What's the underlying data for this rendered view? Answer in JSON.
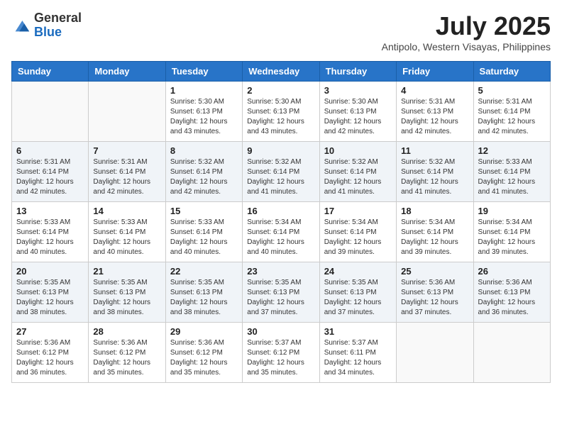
{
  "logo": {
    "general": "General",
    "blue": "Blue"
  },
  "header": {
    "month": "July 2025",
    "location": "Antipolo, Western Visayas, Philippines"
  },
  "weekdays": [
    "Sunday",
    "Monday",
    "Tuesday",
    "Wednesday",
    "Thursday",
    "Friday",
    "Saturday"
  ],
  "weeks": [
    [
      {
        "day": "",
        "info": ""
      },
      {
        "day": "",
        "info": ""
      },
      {
        "day": "1",
        "info": "Sunrise: 5:30 AM\nSunset: 6:13 PM\nDaylight: 12 hours and 43 minutes."
      },
      {
        "day": "2",
        "info": "Sunrise: 5:30 AM\nSunset: 6:13 PM\nDaylight: 12 hours and 43 minutes."
      },
      {
        "day": "3",
        "info": "Sunrise: 5:30 AM\nSunset: 6:13 PM\nDaylight: 12 hours and 42 minutes."
      },
      {
        "day": "4",
        "info": "Sunrise: 5:31 AM\nSunset: 6:13 PM\nDaylight: 12 hours and 42 minutes."
      },
      {
        "day": "5",
        "info": "Sunrise: 5:31 AM\nSunset: 6:14 PM\nDaylight: 12 hours and 42 minutes."
      }
    ],
    [
      {
        "day": "6",
        "info": "Sunrise: 5:31 AM\nSunset: 6:14 PM\nDaylight: 12 hours and 42 minutes."
      },
      {
        "day": "7",
        "info": "Sunrise: 5:31 AM\nSunset: 6:14 PM\nDaylight: 12 hours and 42 minutes."
      },
      {
        "day": "8",
        "info": "Sunrise: 5:32 AM\nSunset: 6:14 PM\nDaylight: 12 hours and 42 minutes."
      },
      {
        "day": "9",
        "info": "Sunrise: 5:32 AM\nSunset: 6:14 PM\nDaylight: 12 hours and 41 minutes."
      },
      {
        "day": "10",
        "info": "Sunrise: 5:32 AM\nSunset: 6:14 PM\nDaylight: 12 hours and 41 minutes."
      },
      {
        "day": "11",
        "info": "Sunrise: 5:32 AM\nSunset: 6:14 PM\nDaylight: 12 hours and 41 minutes."
      },
      {
        "day": "12",
        "info": "Sunrise: 5:33 AM\nSunset: 6:14 PM\nDaylight: 12 hours and 41 minutes."
      }
    ],
    [
      {
        "day": "13",
        "info": "Sunrise: 5:33 AM\nSunset: 6:14 PM\nDaylight: 12 hours and 40 minutes."
      },
      {
        "day": "14",
        "info": "Sunrise: 5:33 AM\nSunset: 6:14 PM\nDaylight: 12 hours and 40 minutes."
      },
      {
        "day": "15",
        "info": "Sunrise: 5:33 AM\nSunset: 6:14 PM\nDaylight: 12 hours and 40 minutes."
      },
      {
        "day": "16",
        "info": "Sunrise: 5:34 AM\nSunset: 6:14 PM\nDaylight: 12 hours and 40 minutes."
      },
      {
        "day": "17",
        "info": "Sunrise: 5:34 AM\nSunset: 6:14 PM\nDaylight: 12 hours and 39 minutes."
      },
      {
        "day": "18",
        "info": "Sunrise: 5:34 AM\nSunset: 6:14 PM\nDaylight: 12 hours and 39 minutes."
      },
      {
        "day": "19",
        "info": "Sunrise: 5:34 AM\nSunset: 6:14 PM\nDaylight: 12 hours and 39 minutes."
      }
    ],
    [
      {
        "day": "20",
        "info": "Sunrise: 5:35 AM\nSunset: 6:13 PM\nDaylight: 12 hours and 38 minutes."
      },
      {
        "day": "21",
        "info": "Sunrise: 5:35 AM\nSunset: 6:13 PM\nDaylight: 12 hours and 38 minutes."
      },
      {
        "day": "22",
        "info": "Sunrise: 5:35 AM\nSunset: 6:13 PM\nDaylight: 12 hours and 38 minutes."
      },
      {
        "day": "23",
        "info": "Sunrise: 5:35 AM\nSunset: 6:13 PM\nDaylight: 12 hours and 37 minutes."
      },
      {
        "day": "24",
        "info": "Sunrise: 5:35 AM\nSunset: 6:13 PM\nDaylight: 12 hours and 37 minutes."
      },
      {
        "day": "25",
        "info": "Sunrise: 5:36 AM\nSunset: 6:13 PM\nDaylight: 12 hours and 37 minutes."
      },
      {
        "day": "26",
        "info": "Sunrise: 5:36 AM\nSunset: 6:13 PM\nDaylight: 12 hours and 36 minutes."
      }
    ],
    [
      {
        "day": "27",
        "info": "Sunrise: 5:36 AM\nSunset: 6:12 PM\nDaylight: 12 hours and 36 minutes."
      },
      {
        "day": "28",
        "info": "Sunrise: 5:36 AM\nSunset: 6:12 PM\nDaylight: 12 hours and 35 minutes."
      },
      {
        "day": "29",
        "info": "Sunrise: 5:36 AM\nSunset: 6:12 PM\nDaylight: 12 hours and 35 minutes."
      },
      {
        "day": "30",
        "info": "Sunrise: 5:37 AM\nSunset: 6:12 PM\nDaylight: 12 hours and 35 minutes."
      },
      {
        "day": "31",
        "info": "Sunrise: 5:37 AM\nSunset: 6:11 PM\nDaylight: 12 hours and 34 minutes."
      },
      {
        "day": "",
        "info": ""
      },
      {
        "day": "",
        "info": ""
      }
    ]
  ]
}
